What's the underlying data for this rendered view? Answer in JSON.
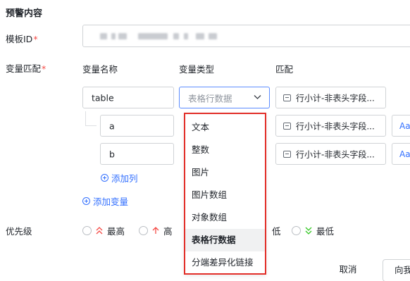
{
  "section_title": "预警内容",
  "template_id": {
    "label": "模板ID",
    "required_mark": "*"
  },
  "variable_match": {
    "label": "变量匹配",
    "required_mark": "*",
    "headers": {
      "name": "变量名称",
      "type": "变量类型",
      "match": "匹配"
    },
    "rows": [
      {
        "name": "table",
        "type": "表格行数据",
        "match": "行小计-非表头字段..."
      },
      {
        "name": "a",
        "match": "行小计-非表头字段...",
        "extra": "Aa"
      },
      {
        "name": "b",
        "match": "行小计-非表头字段...",
        "extra": "Aa"
      }
    ],
    "add_column": "添加列",
    "add_variable": "添加变量"
  },
  "type_dropdown": {
    "options": [
      "文本",
      "整数",
      "图片",
      "图片数组",
      "对象数组",
      "表格行数据",
      "分端差异化链接"
    ],
    "selected": "表格行数据"
  },
  "priority": {
    "label": "优先级",
    "options": [
      {
        "label": "最高",
        "icon": "double-chevron-up-icon",
        "color": "#f54a45"
      },
      {
        "label": "高",
        "icon": "arrow-up-icon",
        "color": "#f54a45"
      },
      {
        "label": "低",
        "icon": "arrow-down-icon",
        "color": "#34c724"
      },
      {
        "label": "最低",
        "icon": "double-chevron-down-icon",
        "color": "#34c724"
      }
    ]
  },
  "footer": {
    "cancel": "取消",
    "next": "向我"
  },
  "colors": {
    "accent": "#3370ff",
    "required": "#f54a45",
    "highlight_border": "#e22e28"
  }
}
